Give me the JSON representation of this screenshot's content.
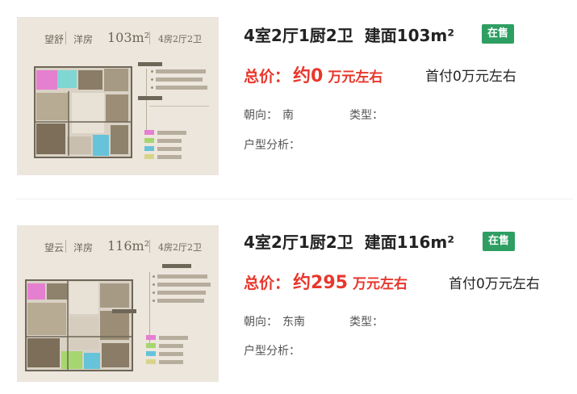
{
  "listings": [
    {
      "thumb": {
        "name": "望舒",
        "type": "洋房",
        "area": "103m²",
        "rooms": "4房2厅2卫"
      },
      "layout": "4室2厅1厨2卫",
      "area": "建面103m²",
      "status": "在售",
      "price_label": "总价：",
      "price_value": "约0",
      "price_unit": "万元左右",
      "down_payment": "首付0万元左右",
      "orientation_label": "朝向：",
      "orientation": "南",
      "type_label": "类型：",
      "type": "",
      "analysis_label": "户型分析：",
      "analysis": ""
    },
    {
      "thumb": {
        "name": "望云",
        "type": "洋房",
        "area": "116m²",
        "rooms": "4房2厅2卫"
      },
      "layout": "4室2厅1厨2卫",
      "area": "建面116m²",
      "status": "在售",
      "price_label": "总价：",
      "price_value": "约295",
      "price_unit": "万元左右",
      "down_payment": "首付0万元左右",
      "orientation_label": "朝向：",
      "orientation": "东南",
      "type_label": "类型：",
      "type": "",
      "analysis_label": "户型分析：",
      "analysis": ""
    }
  ],
  "colors": {
    "price_red": "#e8372c",
    "status_green": "#2e9e62",
    "thumb_bg": "#ece6dd"
  }
}
